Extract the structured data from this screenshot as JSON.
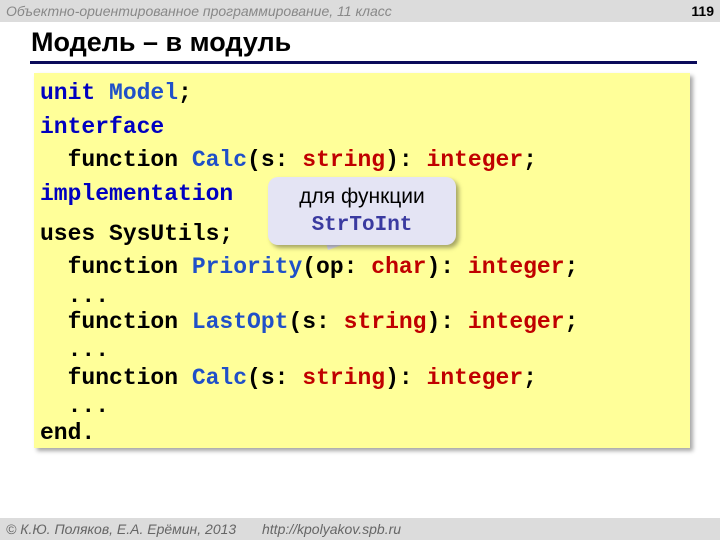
{
  "header": {
    "course": "Объектно-ориентированное программирование, 11 класс",
    "page": "119"
  },
  "title": "Модель – в модуль",
  "code": [
    [
      [
        "kw",
        "unit "
      ],
      [
        "id",
        "Model"
      ],
      [
        "pl",
        ";"
      ]
    ],
    [
      [
        "kw",
        "interface"
      ]
    ],
    [
      [
        "pl",
        "  function "
      ],
      [
        "id",
        "Calc"
      ],
      [
        "pl",
        "(s: "
      ],
      [
        "ty",
        "string"
      ],
      [
        "pl",
        "): "
      ],
      [
        "ty",
        "integer"
      ],
      [
        "pl",
        ";"
      ]
    ],
    [
      [
        "kw",
        "implementation"
      ]
    ],
    [
      [
        "pl",
        "uses SysUtils;"
      ]
    ],
    [
      [
        "pl",
        "  function "
      ],
      [
        "id",
        "Priority"
      ],
      [
        "pl",
        "(op: "
      ],
      [
        "ty",
        "char"
      ],
      [
        "pl",
        "): "
      ],
      [
        "ty",
        "integer"
      ],
      [
        "pl",
        ";"
      ]
    ],
    [
      [
        "pl",
        "  ..."
      ]
    ],
    [
      [
        "pl",
        "  function "
      ],
      [
        "id",
        "LastOpt"
      ],
      [
        "pl",
        "(s: "
      ],
      [
        "ty",
        "string"
      ],
      [
        "pl",
        "): "
      ],
      [
        "ty",
        "integer"
      ],
      [
        "pl",
        ";"
      ]
    ],
    [
      [
        "pl",
        "  ..."
      ]
    ],
    [
      [
        "pl",
        "  function "
      ],
      [
        "id",
        "Calc"
      ],
      [
        "pl",
        "(s: "
      ],
      [
        "ty",
        "string"
      ],
      [
        "pl",
        "): "
      ],
      [
        "ty",
        "integer"
      ],
      [
        "pl",
        ";"
      ]
    ],
    [
      [
        "pl",
        "  ..."
      ]
    ],
    [
      [
        "pl",
        "end."
      ]
    ]
  ],
  "callout": {
    "line1": "для функции",
    "line2": "StrToInt"
  },
  "footer": {
    "copyright": "© К.Ю. Поляков, Е.А. Ерёмин, 2013",
    "url": "http://kpolyakov.spb.ru"
  },
  "colors": {
    "keyword": "#0000c0",
    "identifier": "#2050c8",
    "type": "#c00000",
    "code_bg": "#ffff99",
    "callout_bg": "#e4e4f4"
  }
}
